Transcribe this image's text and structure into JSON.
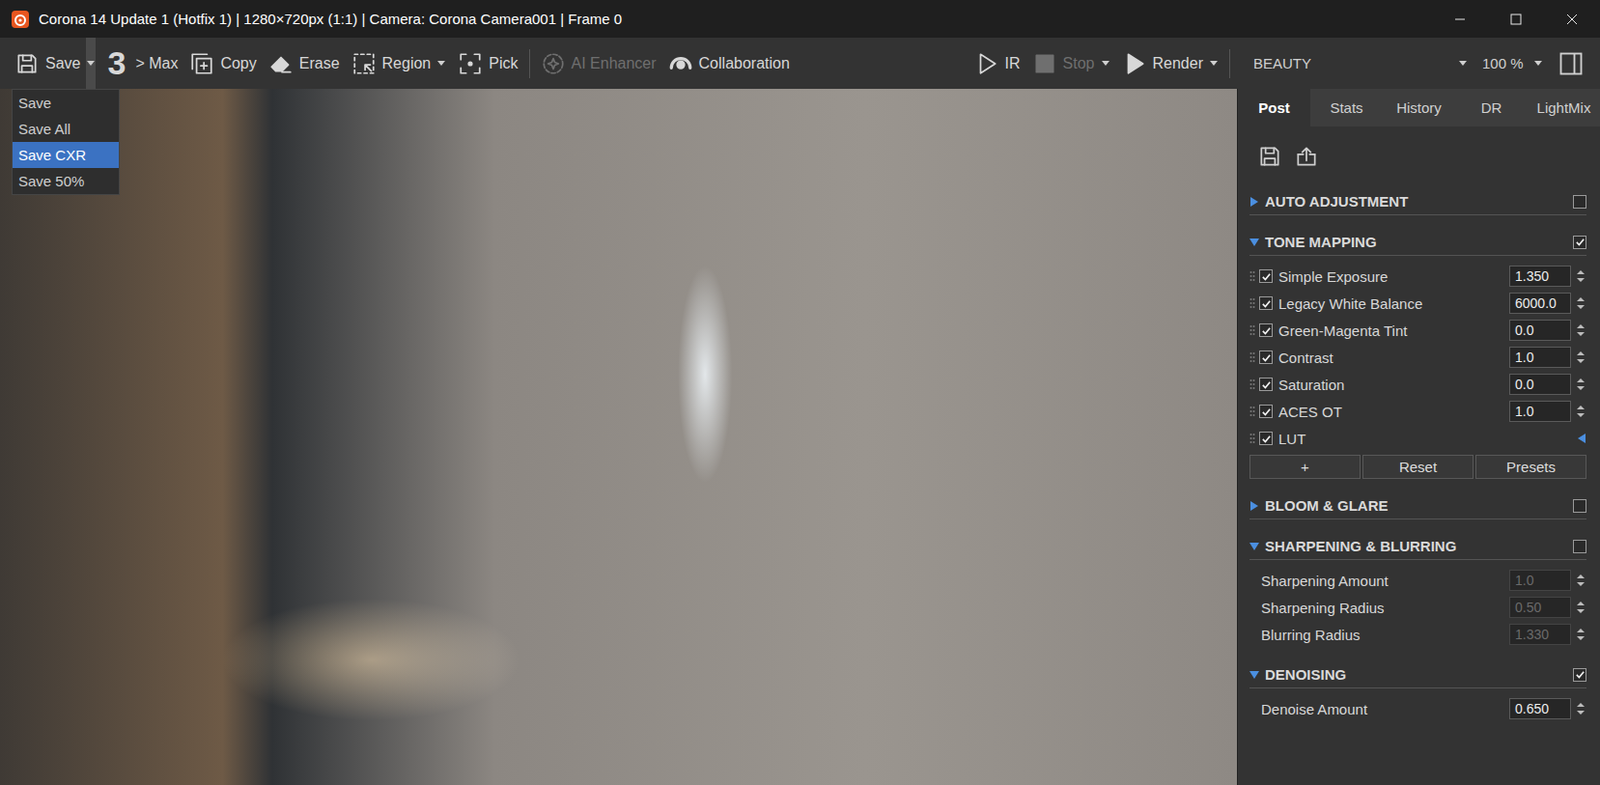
{
  "window": {
    "title": "Corona 14 Update 1 (Hotfix 1) | 1280×720px (1:1) | Camera: Corona Camera001 | Frame 0"
  },
  "toolbar": {
    "left_groups": [
      [
        {
          "kind": "save",
          "label": "Save",
          "dropdown": true,
          "open": true,
          "disabled": false
        },
        {
          "kind": "max",
          "badge": "3",
          "label": "> Max",
          "dropdown": false,
          "open": false,
          "disabled": false
        },
        {
          "kind": "copy",
          "label": "Copy",
          "dropdown": false,
          "open": false,
          "disabled": false
        },
        {
          "kind": "erase",
          "label": "Erase",
          "dropdown": false,
          "open": false,
          "disabled": false
        },
        {
          "kind": "region",
          "label": "Region",
          "dropdown": true,
          "open": false,
          "disabled": false
        },
        {
          "kind": "pick",
          "label": "Pick",
          "dropdown": false,
          "open": false,
          "disabled": false
        }
      ],
      [
        {
          "kind": "ai",
          "label": "AI Enhancer",
          "dropdown": false,
          "open": false,
          "disabled": true
        },
        {
          "kind": "collab",
          "label": "Collaboration",
          "dropdown": false,
          "open": false,
          "disabled": false
        }
      ]
    ],
    "right_group": [
      {
        "kind": "ir",
        "label": "IR",
        "dropdown": false,
        "open": false,
        "disabled": false
      },
      {
        "kind": "stop",
        "label": "Stop",
        "dropdown": true,
        "open": false,
        "disabled": true
      },
      {
        "kind": "render",
        "label": "Render",
        "dropdown": true,
        "open": false,
        "disabled": false
      }
    ],
    "selects": [
      {
        "value": "BEAUTY",
        "wide": true
      },
      {
        "value": "100 %",
        "wide": false
      }
    ]
  },
  "save_menu": {
    "items": [
      {
        "label": "Save",
        "selected": false
      },
      {
        "label": "Save All",
        "selected": false
      },
      {
        "label": "Save CXR",
        "selected": true
      },
      {
        "label": "Save 50%",
        "selected": false
      }
    ]
  },
  "panel": {
    "tabs": [
      {
        "label": "Post",
        "selected": true
      },
      {
        "label": "Stats",
        "selected": false
      },
      {
        "label": "History",
        "selected": false
      },
      {
        "label": "DR",
        "selected": false
      },
      {
        "label": "LightMix",
        "selected": false
      }
    ],
    "sections": [
      {
        "title": "AUTO ADJUSTMENT",
        "expanded": false,
        "enabled": false,
        "rows": [],
        "buttons": []
      },
      {
        "title": "TONE MAPPING",
        "expanded": true,
        "enabled": true,
        "rows": [
          {
            "kind": "operator",
            "label": "Simple Exposure",
            "checked": true,
            "value": "1.350",
            "disabled": false
          },
          {
            "kind": "operator",
            "label": "Legacy White Balance",
            "checked": true,
            "value": "6000.0",
            "disabled": false
          },
          {
            "kind": "operator",
            "label": "Green-Magenta Tint",
            "checked": true,
            "value": "0.0",
            "disabled": false
          },
          {
            "kind": "operator",
            "label": "Contrast",
            "checked": true,
            "value": "1.0",
            "disabled": false
          },
          {
            "kind": "operator",
            "label": "Saturation",
            "checked": true,
            "value": "0.0",
            "disabled": false
          },
          {
            "kind": "operator",
            "label": "ACES OT",
            "checked": true,
            "value": "1.0",
            "disabled": false
          },
          {
            "kind": "lut",
            "label": "LUT",
            "checked": true,
            "value": "",
            "disabled": false
          }
        ],
        "buttons": [
          "+",
          "Reset",
          "Presets"
        ]
      },
      {
        "title": "BLOOM & GLARE",
        "expanded": false,
        "enabled": false,
        "rows": [],
        "buttons": []
      },
      {
        "title": "SHARPENING & BLURRING",
        "expanded": true,
        "enabled": false,
        "rows": [
          {
            "kind": "param",
            "label": "Sharpening Amount",
            "checked": false,
            "value": "1.0",
            "disabled": true
          },
          {
            "kind": "param",
            "label": "Sharpening Radius",
            "checked": false,
            "value": "0.50",
            "disabled": true
          },
          {
            "kind": "param",
            "label": "Blurring Radius",
            "checked": false,
            "value": "1.330",
            "disabled": true
          }
        ],
        "buttons": []
      },
      {
        "title": "DENOISING",
        "expanded": true,
        "enabled": true,
        "rows": [
          {
            "kind": "param",
            "label": "Denoise Amount",
            "checked": false,
            "value": "0.650",
            "disabled": false
          }
        ],
        "buttons": []
      }
    ]
  }
}
